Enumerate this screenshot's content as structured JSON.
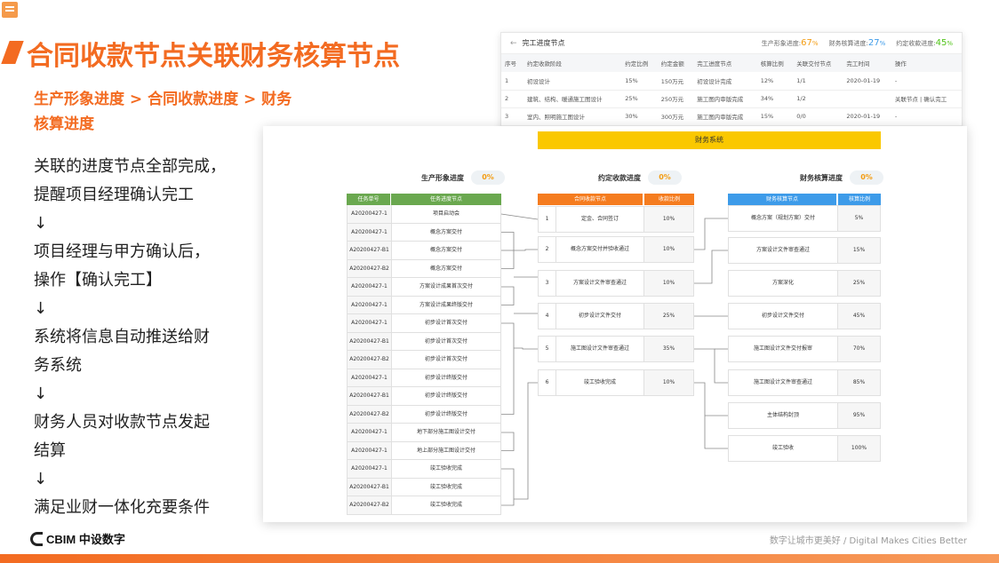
{
  "slide": {
    "title": "合同收款节点关联财务核算节点",
    "subtitle": "生产形象进度 > 合同收款进度 > 财务核算进度",
    "flow": [
      "关联的进度节点全部完成，",
      "提醒项目经理确认完工",
      "↓",
      "项目经理与甲方确认后，",
      "操作【确认完工】",
      "↓",
      "系统将信息自动推送给财",
      "务系统",
      "↓",
      "财务人员对收款节点发起",
      "结算",
      "↓",
      "满足业财一体化充要条件"
    ],
    "logo_text": "CBIM 中设数字",
    "slogan": "数字让城市更美好 / Digital Makes Cities Better"
  },
  "completion_window": {
    "back_arrow": "←",
    "title": "完工进度节点",
    "progress": [
      {
        "label": "生产形象进度:",
        "value": "67",
        "unit": "%",
        "color": "#f39c12"
      },
      {
        "label": "财务核算进度:",
        "value": "27",
        "unit": "%",
        "color": "#3d9be9"
      },
      {
        "label": "约定收款进度:",
        "value": "45",
        "unit": "%",
        "color": "#52c41a"
      }
    ],
    "columns": [
      "序号",
      "约定收款阶段",
      "约定比例",
      "约定金额",
      "完工进度节点",
      "核算比例",
      "关联交付节点",
      "完工时间",
      "操作"
    ],
    "rows": [
      {
        "no": "1",
        "stage": "初设设计",
        "ratio": "15%",
        "amount": "150万元",
        "node": "初设设计完成",
        "calc": "12%",
        "link": "1/1",
        "date": "2020-01-19",
        "op": "-"
      },
      {
        "no": "2",
        "stage": "建筑、结构、暖通施工图设计",
        "ratio": "25%",
        "amount": "250万元",
        "node": "施工图内审版完成",
        "calc": "34%",
        "link": "1/2",
        "date": "",
        "op": "关联节点 | 确认完工"
      },
      {
        "no": "3",
        "stage": "室内、照明施工图设计",
        "ratio": "30%",
        "amount": "300万元",
        "node": "施工图内审版完成",
        "calc": "15%",
        "link": "0/0",
        "date": "2020-01-19",
        "op": "-"
      }
    ]
  },
  "finance_window": {
    "title": "财务系统",
    "production": {
      "label": "生产形象进度",
      "progress": "0%",
      "header_color": "#6aa84f",
      "columns": [
        "任务单号",
        "任务进度节点"
      ],
      "rows": [
        [
          "A20200427-1",
          "项目启动会"
        ],
        [
          "A20200427-1",
          "概念方案交付"
        ],
        [
          "A20200427-B1",
          "概念方案交付"
        ],
        [
          "A20200427-B2",
          "概念方案交付"
        ],
        [
          "A20200427-1",
          "方案设计成果首次交付"
        ],
        [
          "A20200427-1",
          "方案设计成果终版交付"
        ],
        [
          "A20200427-1",
          "初步设计首次交付"
        ],
        [
          "A20200427-B1",
          "初步设计首次交付"
        ],
        [
          "A20200427-B2",
          "初步设计首次交付"
        ],
        [
          "A20200427-1",
          "初步设计终版交付"
        ],
        [
          "A20200427-B1",
          "初步设计终版交付"
        ],
        [
          "A20200427-B2",
          "初步设计终版交付"
        ],
        [
          "A20200427-1",
          "地下部分施工图设计交付"
        ],
        [
          "A20200427-1",
          "地上部分施工图设计交付"
        ],
        [
          "A20200427-1",
          "竣工验收完成"
        ],
        [
          "A20200427-B1",
          "竣工验收完成"
        ],
        [
          "A20200427-B2",
          "竣工验收完成"
        ]
      ]
    },
    "contract": {
      "label": "约定收款进度",
      "progress": "0%",
      "header_color": "#f57c1f",
      "columns": [
        "合同收款节点",
        "收款比例"
      ],
      "rows": [
        [
          "1",
          "定金、合同签订",
          "10%"
        ],
        [
          "2",
          "概念方案交付并验收通过",
          "10%"
        ],
        [
          "3",
          "方案设计文件审查通过",
          "10%"
        ],
        [
          "4",
          "初步设计文件交付",
          "25%"
        ],
        [
          "5",
          "施工图设计文件审查通过",
          "35%"
        ],
        [
          "6",
          "竣工验收完成",
          "10%"
        ]
      ]
    },
    "finance": {
      "label": "财务核算进度",
      "progress": "0%",
      "header_color": "#3d9be9",
      "columns": [
        "财务核算节点",
        "核算比例"
      ],
      "rows": [
        [
          "概念方案（规划方案）交付",
          "5%"
        ],
        [
          "方案设计文件审查通过",
          "15%"
        ],
        [
          "方案深化",
          "25%"
        ],
        [
          "初步设计文件交付",
          "45%"
        ],
        [
          "施工图设计文件交付报审",
          "70%"
        ],
        [
          "施工图设计文件审查通过",
          "85%"
        ],
        [
          "主体结构封顶",
          "95%"
        ],
        [
          "竣工验收",
          "100%"
        ]
      ]
    }
  }
}
